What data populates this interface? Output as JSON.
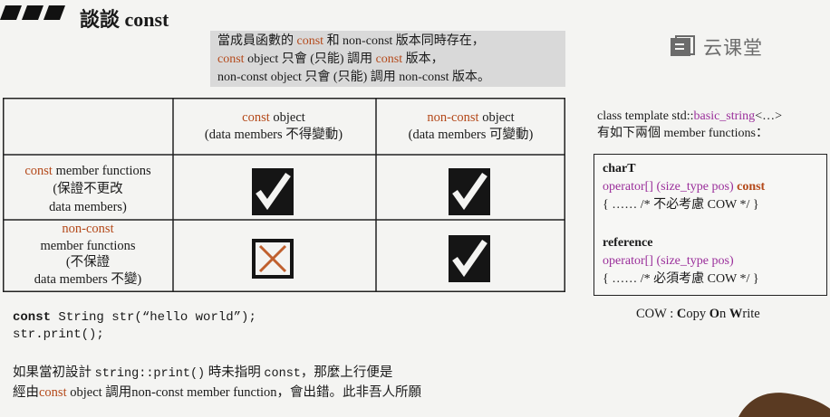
{
  "header": {
    "title": "談談 const"
  },
  "note": {
    "line1": {
      "a": "當成員函數的 ",
      "b": "const",
      "c": " 和 non-const 版本同時存在，"
    },
    "line2": {
      "a": "const",
      "b": " object 只會 (只能) 調用 ",
      "c": "const",
      "d": " 版本，"
    },
    "line3": "non-const object 只會 (只能) 調用 non-const 版本。"
  },
  "logo": {
    "icon": "cloud-classroom-icon",
    "text": "云课堂"
  },
  "table": {
    "col1": {
      "kw": "const",
      "rest": " object",
      "sub": "(data members 不得變動)"
    },
    "col2": {
      "kw": "non-const",
      "rest": " object",
      "sub": "(data members 可變動)"
    },
    "row1": {
      "kw": "const",
      "rest": " member functions",
      "l2": "(保證不更改",
      "l3": "data members)"
    },
    "row2": {
      "kw": "non-const",
      "l2": "member functions",
      "l3": "(不保證",
      "l4": "data members 不變)"
    },
    "cells": {
      "r1c1": "check",
      "r1c2": "check",
      "r2c1": "cross",
      "r2c2": "check"
    }
  },
  "right": {
    "intro1": {
      "a": "class template std::",
      "b": "basic_string",
      "c": "<…>"
    },
    "intro2": "有如下兩個 member functions：",
    "f1_type": "charT",
    "f1_sig": {
      "a": "operator[] (size_type pos) ",
      "b": "const"
    },
    "f1_body": "{ …… /* 不必考慮 COW */ }",
    "f2_type": "reference",
    "f2_sig": "operator[] (size_type pos)",
    "f2_body": "{ …… /* 必須考慮 COW */ }",
    "cow": {
      "a": "COW : ",
      "b": "C",
      "c": "opy ",
      "d": "O",
      "e": "n ",
      "f": "W",
      "g": "rite"
    }
  },
  "code": {
    "line1_kw": "const",
    "line1_rest": " String str(“hello world”);",
    "line2": "str.print();"
  },
  "bottom": {
    "line1": {
      "a": "如果當初設計 ",
      "b": "string::print()",
      "c": " 時未指明 ",
      "d": "const",
      "e": "，那麼上行便是"
    },
    "line2": {
      "a": "經由",
      "b": "const",
      "c": " object 調用non-const member function，會出錯。此非吾人所願"
    }
  },
  "colors": {
    "accent": "#b4491a",
    "purple": "#9a2e9a",
    "note_bg": "#d9d9d9",
    "check": "#151515",
    "cross": "#c0602e"
  }
}
